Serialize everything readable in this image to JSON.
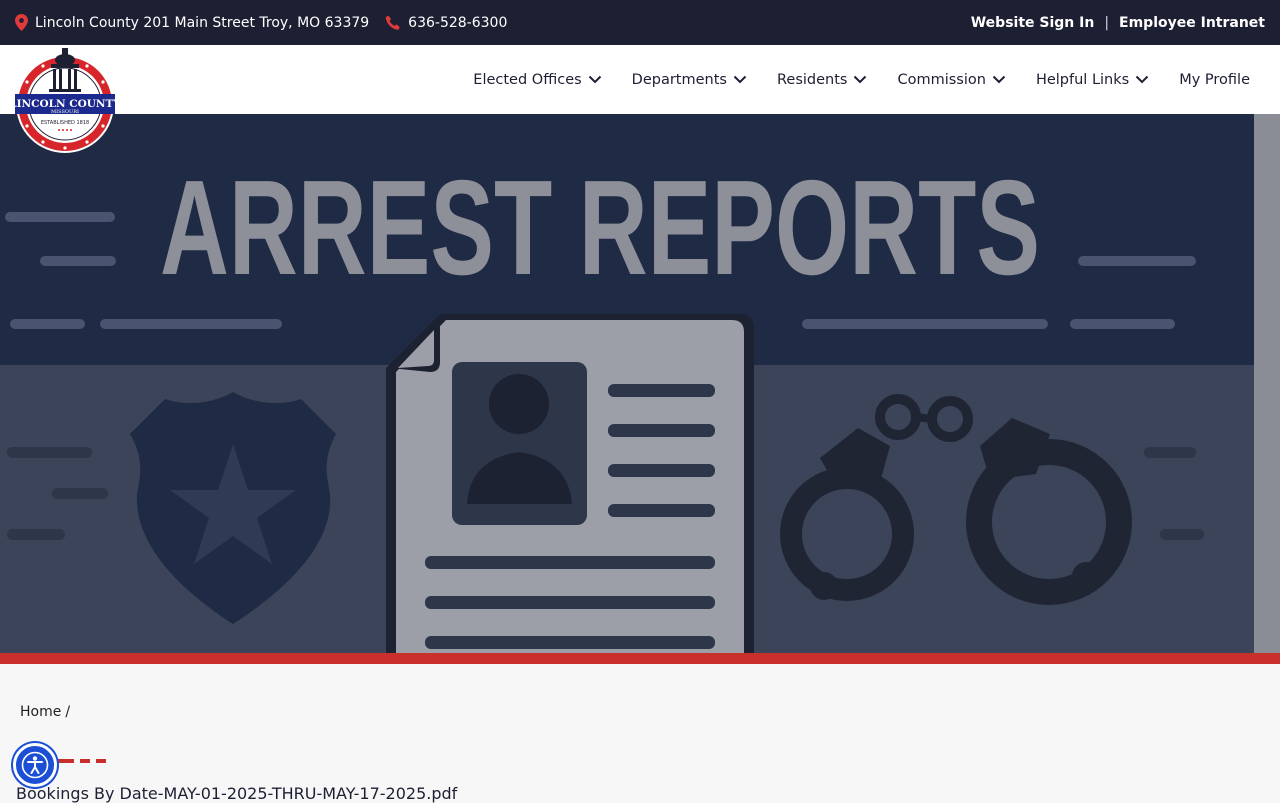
{
  "topbar": {
    "address": "Lincoln County 201 Main Street Troy, MO 63379",
    "phone": "636-528-6300",
    "sign_in": "Website Sign In",
    "separator": "|",
    "intranet": "Employee Intranet"
  },
  "logo": {
    "name": "LINCOLN COUNTY",
    "state": "MISSOURI",
    "established": "ESTABLISHED 1818"
  },
  "nav": {
    "items": [
      {
        "label": "Elected Offices",
        "dropdown": true
      },
      {
        "label": "Departments",
        "dropdown": true
      },
      {
        "label": "Residents",
        "dropdown": true
      },
      {
        "label": "Commission",
        "dropdown": true
      },
      {
        "label": "Helpful Links",
        "dropdown": true
      },
      {
        "label": "My Profile",
        "dropdown": false
      }
    ]
  },
  "hero": {
    "title": "ARREST REPORTS"
  },
  "breadcrumb": {
    "home": "Home",
    "separator": "/"
  },
  "document": {
    "title": "Bookings By Date-MAY-01-2025-THRU-MAY-17-2025.pdf"
  },
  "colors": {
    "topbar_bg": "#1d1f33",
    "accent_red": "#c9302c",
    "hero_dark": "#1f2a44",
    "accessibility_blue": "#1a4fd6"
  },
  "icons": {
    "location": "map-pin-icon",
    "phone": "phone-icon",
    "chevron": "chevron-down-icon",
    "accessibility": "accessibility-icon"
  }
}
